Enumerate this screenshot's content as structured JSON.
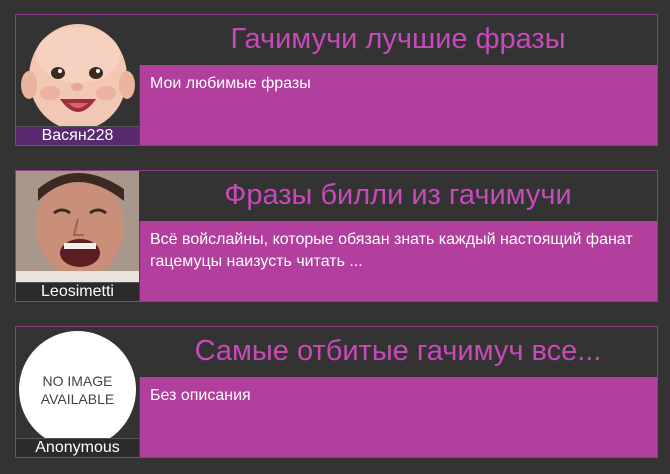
{
  "cards": [
    {
      "title": "Гачимучи лучшие фразы",
      "description": "Мои любимые фразы",
      "author": "Васян228"
    },
    {
      "title": "Фразы билли из гачимучи",
      "description": "Всё войслайны, которые обязан знать каждый настоящий фанат гацемуцы наизусть читать ...",
      "author": "Leosimetti"
    },
    {
      "title": "Самые отбитые гачимуч все...",
      "description": "Без описания",
      "author": "Anonymous",
      "no_image_line1": "NO IMAGE",
      "no_image_line2": "AVAILABLE"
    }
  ],
  "colors": {
    "background": "#333333",
    "accent_title": "#c74ab8",
    "description_bg": "#b23e9e",
    "border": "#8e3d86"
  }
}
